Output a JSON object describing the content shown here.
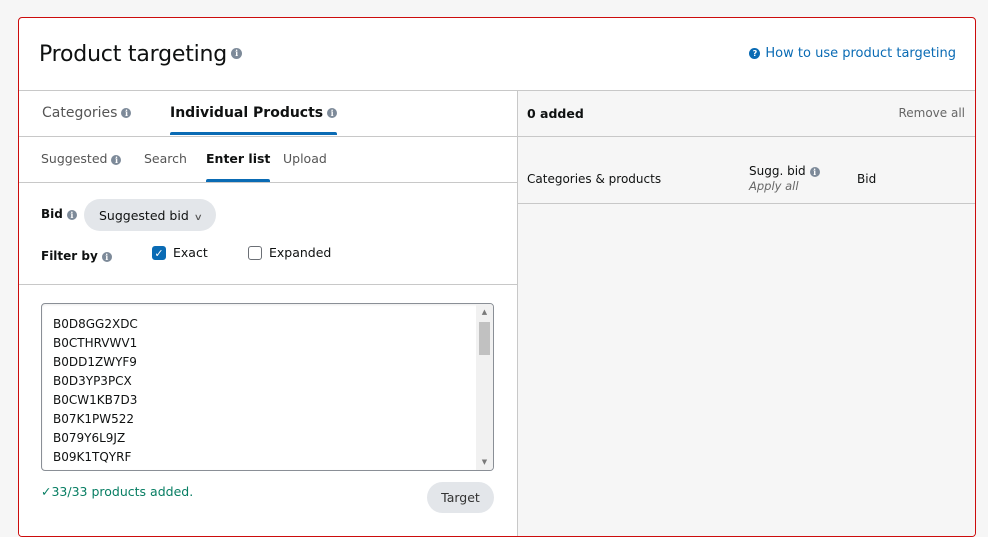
{
  "header": {
    "title": "Product targeting",
    "help_link": "How to use product targeting",
    "info_glyph": "i",
    "help_glyph": "?"
  },
  "main_tabs": [
    {
      "label": "Categories",
      "active": false,
      "has_info": true
    },
    {
      "label": "Individual Products",
      "active": true,
      "has_info": true
    }
  ],
  "sub_tabs": [
    {
      "label": "Suggested",
      "active": false,
      "has_info": true
    },
    {
      "label": "Search",
      "active": false
    },
    {
      "label": "Enter list",
      "active": true
    },
    {
      "label": "Upload",
      "active": false
    }
  ],
  "bid": {
    "label": "Bid",
    "selected": "Suggested bid",
    "chevron": "⌄"
  },
  "filter": {
    "label": "Filter by",
    "options": [
      {
        "label": "Exact",
        "checked": true
      },
      {
        "label": "Expanded",
        "checked": false
      }
    ],
    "check_glyph": "✓"
  },
  "asin_list": {
    "visible_items": [
      "B0D8GG2XDC",
      "B0CTHRVWV1",
      "B0DD1ZWYF9",
      "B0D3YP3PCX",
      "B0CW1KB7D3",
      "B07K1PW522",
      "B079Y6L9JZ",
      "B09K1TQYRF"
    ]
  },
  "status": {
    "check": "✓",
    "message": "33/33 products added."
  },
  "target_button": "Target",
  "right_panel": {
    "added": "0 added",
    "remove_all": "Remove all",
    "columns": {
      "categories_products": "Categories & products",
      "sugg_bid": "Sugg. bid",
      "apply_all": "Apply all",
      "bid": "Bid"
    }
  },
  "colors": {
    "accent": "#0a6bb4",
    "card_border": "#cc0c0c",
    "success": "#067d62"
  }
}
